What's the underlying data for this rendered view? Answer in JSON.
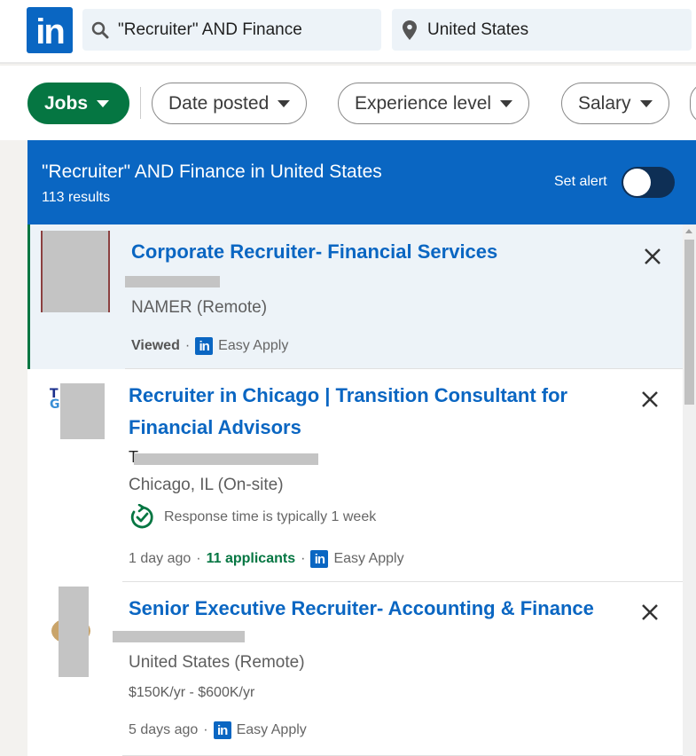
{
  "topbar": {
    "logo_text": "in",
    "search_keywords": "\"Recruiter\" AND Finance",
    "search_location": "United States"
  },
  "filters": {
    "jobs_label": "Jobs",
    "pills": [
      "Date posted",
      "Experience level",
      "Salary"
    ]
  },
  "results_header": {
    "title": "\"Recruiter\" AND Finance in United States",
    "count": "113 results",
    "set_alert_label": "Set alert",
    "alert_on": false
  },
  "jobs": [
    {
      "title": "Corporate Recruiter- Financial Services",
      "location": "NAMER (Remote)",
      "status": "Viewed",
      "apply": "Easy Apply",
      "selected": true
    },
    {
      "title": "Recruiter in Chicago | Transition Consultant for Financial Advisors",
      "company_initial": "T",
      "location": "Chicago, IL (On-site)",
      "response": "Response time is typically 1 week",
      "posted": "1 day ago",
      "applicants": "11 applicants",
      "apply": "Easy Apply"
    },
    {
      "title": "Senior Executive Recruiter- Accounting & Finance",
      "location": "United States (Remote)",
      "salary": "$150K/yr - $600K/yr",
      "posted": "5 days ago",
      "apply": "Easy Apply"
    }
  ],
  "colors": {
    "brand": "#0a66c2",
    "green": "#057642",
    "toggle": "#0e2f55"
  }
}
